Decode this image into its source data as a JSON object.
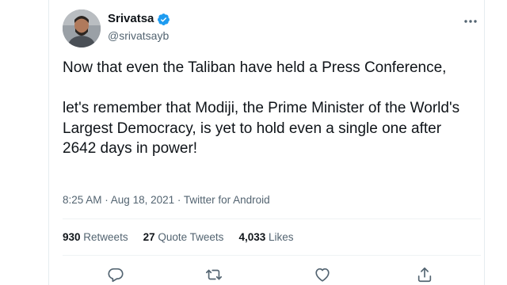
{
  "tweet": {
    "author": {
      "display_name": "Srivatsa",
      "handle": "@srivatsayb",
      "verified": true
    },
    "text": {
      "paragraph_1": "Now that even the Taliban have held a Press Conference,",
      "paragraph_2": "let's remember that Modiji, the Prime Minister of the World's Largest Democracy, is yet to hold even a single one after 2642 days in power!"
    },
    "meta": {
      "time": "8:25 AM",
      "separator_1": " · ",
      "date": "Aug 18, 2021",
      "separator_2": " · ",
      "source": "Twitter for Android"
    },
    "stats": {
      "retweets_count": "930",
      "retweets_label": "Retweets",
      "quote_tweets_count": "27",
      "quote_tweets_label": "Quote Tweets",
      "likes_count": "4,033",
      "likes_label": "Likes"
    },
    "actions": {
      "icons": [
        "reply-icon",
        "retweet-icon",
        "like-icon",
        "share-icon"
      ]
    }
  },
  "colors": {
    "text_primary": "#0f1419",
    "text_secondary": "#536471",
    "verified_blue": "#1d9bf0",
    "border": "#eff3f4"
  }
}
